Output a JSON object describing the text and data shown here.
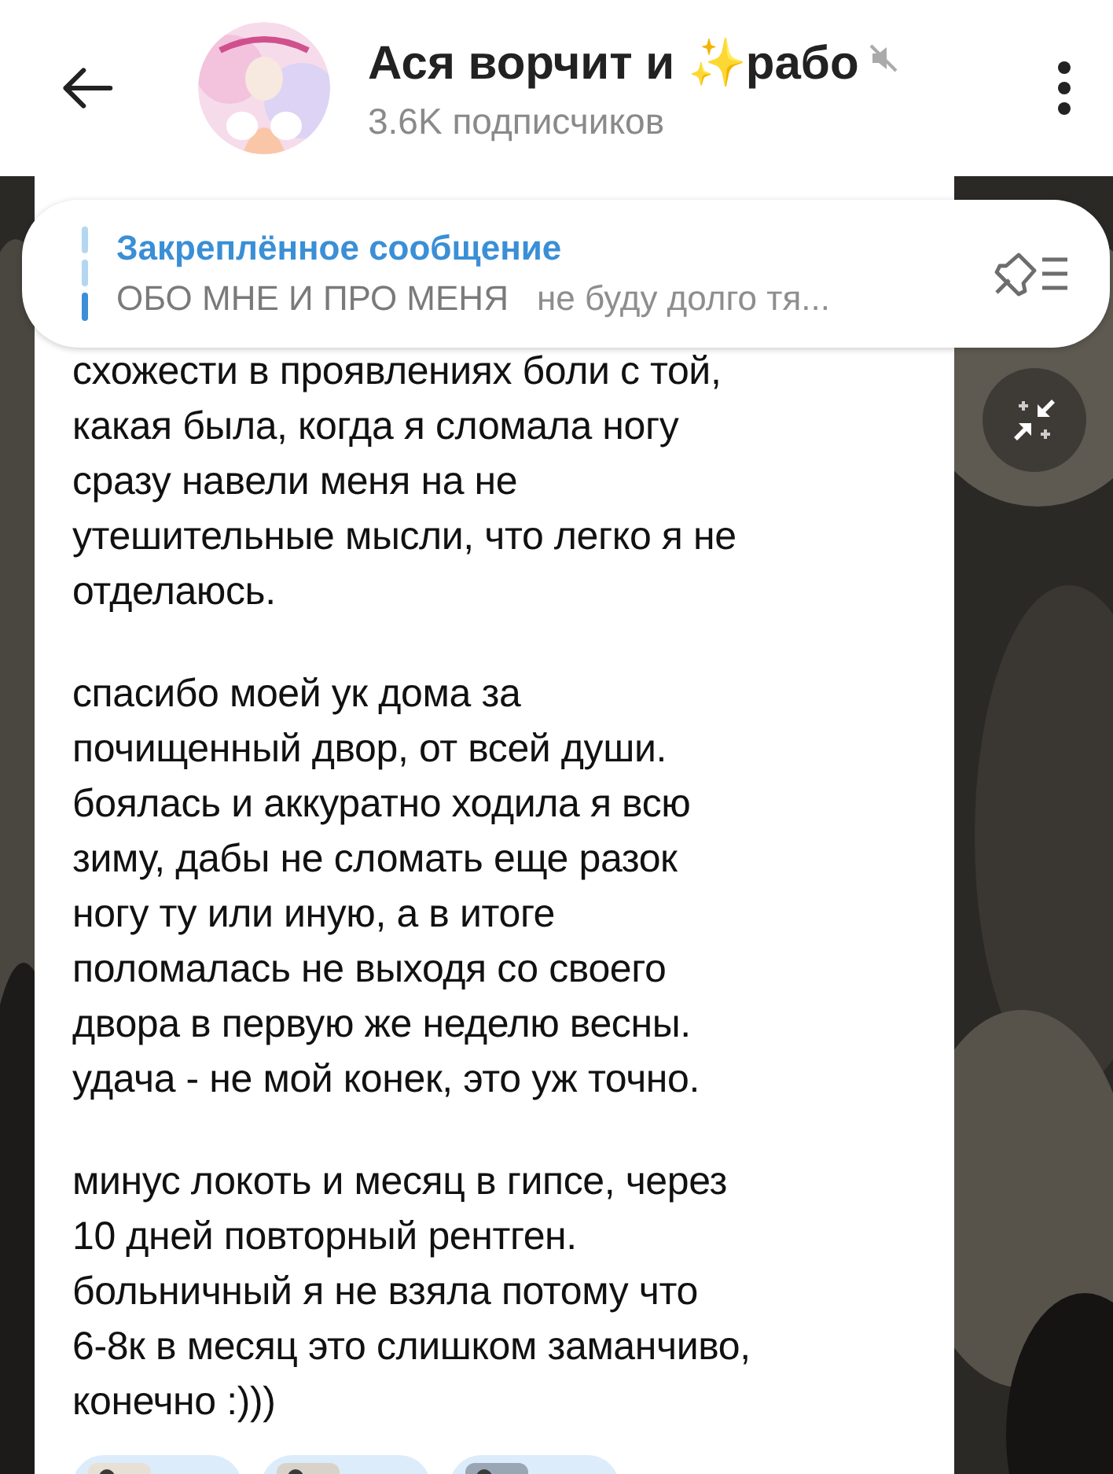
{
  "header": {
    "title": "Ася ворчит и ✨рабо",
    "muted": true,
    "subtitle": "3.6K подписчиков"
  },
  "pinned": {
    "title": "Закреплённое сообщение",
    "preview_title": "ОБО МНЕ И ПРО МЕНЯ",
    "preview_text": "не буду долго тя..."
  },
  "message": {
    "paragraphs": [
      "схожести в проявлениях боли с той,\nкакая была, когда я сломала ногу\nсразу навели меня на не\nутешительные мысли, что легко я не\nотделаюсь.",
      "спасибо моей ук дома за\nпочищенный двор, от всей души.\nбоялась и аккуратно ходила я всю\nзиму, дабы не сломать еще разок\nногу ту или иную, а в итоге\nполомалась не выходя со своего\nдвора в первую же неделю весны.\nудача - не мой конек, это уж точно.",
      "минус локоть и месяц в гипсе, через\n10 дней повторный рентген.\nбольничный я не взяла потому что\n6-8к в месяц это слишком заманчиво,\nконечно :)))"
    ]
  }
}
